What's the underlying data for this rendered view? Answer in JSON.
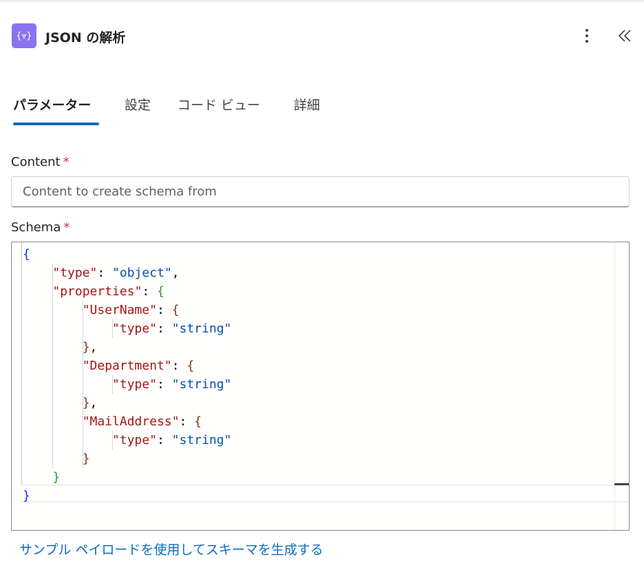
{
  "header": {
    "icon_text": "{⩔}",
    "title": "JSON の解析"
  },
  "tabs": [
    {
      "label": "パラメーター",
      "active": true
    },
    {
      "label": "設定",
      "active": false
    },
    {
      "label": "コード ビュー",
      "active": false
    },
    {
      "label": "詳細",
      "active": false
    }
  ],
  "content": {
    "label": "Content",
    "required_mark": "*",
    "placeholder": "Content to create schema from",
    "value": ""
  },
  "schema": {
    "label": "Schema",
    "required_mark": "*",
    "lines": [
      [
        {
          "t": "{",
          "c": "b1"
        }
      ],
      [
        {
          "t": "    "
        },
        {
          "t": "\"type\"",
          "c": "k"
        },
        {
          "t": ": "
        },
        {
          "t": "\"object\"",
          "c": "s"
        },
        {
          "t": ","
        }
      ],
      [
        {
          "t": "    "
        },
        {
          "t": "\"properties\"",
          "c": "k"
        },
        {
          "t": ": "
        },
        {
          "t": "{",
          "c": "b2"
        }
      ],
      [
        {
          "t": "        "
        },
        {
          "t": "\"UserName\"",
          "c": "k"
        },
        {
          "t": ": "
        },
        {
          "t": "{",
          "c": "b3"
        }
      ],
      [
        {
          "t": "            "
        },
        {
          "t": "\"type\"",
          "c": "k"
        },
        {
          "t": ": "
        },
        {
          "t": "\"string\"",
          "c": "s"
        }
      ],
      [
        {
          "t": "        "
        },
        {
          "t": "}",
          "c": "b3"
        },
        {
          "t": ","
        }
      ],
      [
        {
          "t": "        "
        },
        {
          "t": "\"Department\"",
          "c": "k"
        },
        {
          "t": ": "
        },
        {
          "t": "{",
          "c": "b3"
        }
      ],
      [
        {
          "t": "            "
        },
        {
          "t": "\"type\"",
          "c": "k"
        },
        {
          "t": ": "
        },
        {
          "t": "\"string\"",
          "c": "s"
        }
      ],
      [
        {
          "t": "        "
        },
        {
          "t": "}",
          "c": "b3"
        },
        {
          "t": ","
        }
      ],
      [
        {
          "t": "        "
        },
        {
          "t": "\"MailAddress\"",
          "c": "k"
        },
        {
          "t": ": "
        },
        {
          "t": "{",
          "c": "b3"
        }
      ],
      [
        {
          "t": "            "
        },
        {
          "t": "\"type\"",
          "c": "k"
        },
        {
          "t": ": "
        },
        {
          "t": "\"string\"",
          "c": "s"
        }
      ],
      [
        {
          "t": "        "
        },
        {
          "t": "}",
          "c": "b3"
        }
      ],
      [
        {
          "t": "    "
        },
        {
          "t": "}",
          "c": "b2"
        }
      ],
      [
        {
          "t": "}",
          "c": "b1"
        }
      ]
    ]
  },
  "generate_link": "サンプル ペイロードを使用してスキーマを生成する"
}
